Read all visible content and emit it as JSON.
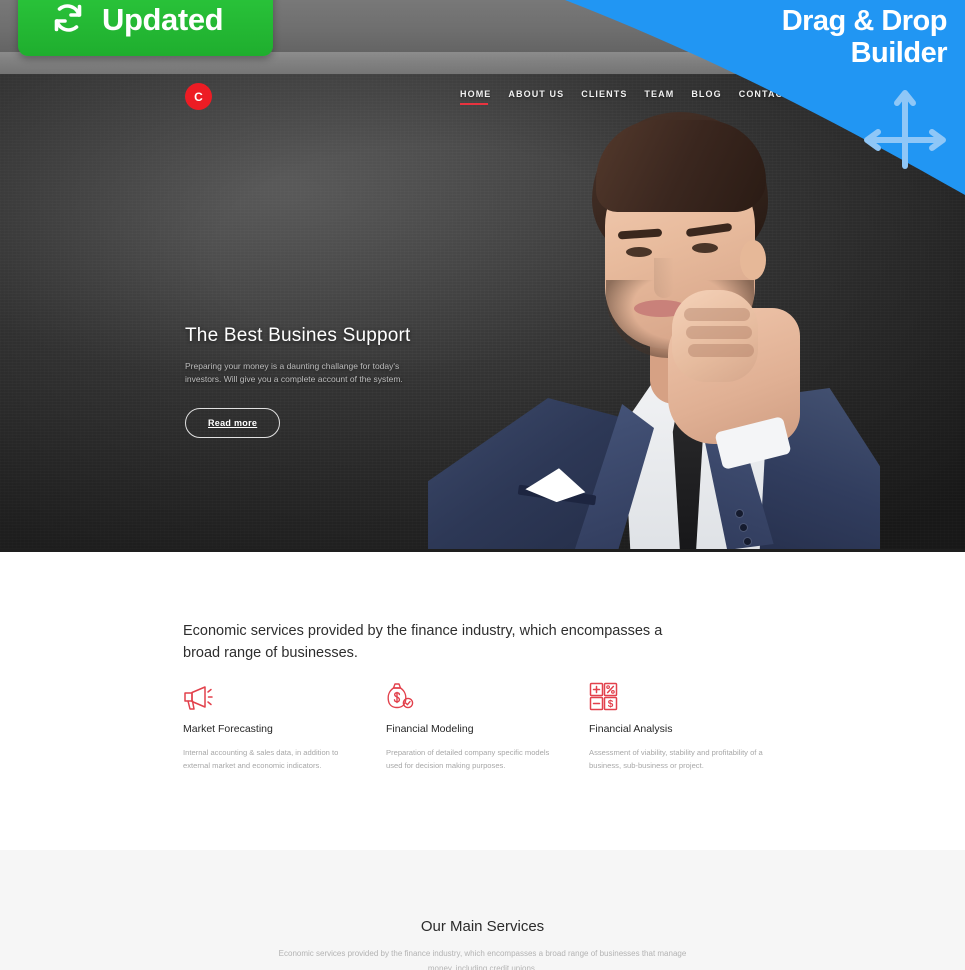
{
  "badges": {
    "updated": {
      "label": "Updated",
      "icon": "sync-refresh-icon",
      "color": "#1fae2e"
    },
    "ribbon": {
      "line1": "Drag & Drop",
      "line2": "Builder",
      "icon": "four-way-drag-arrows-icon",
      "color": "#2196f3"
    }
  },
  "site": {
    "logo": {
      "letter": "C",
      "color": "#ed1c24"
    },
    "nav": [
      {
        "label": "HOME",
        "active": true
      },
      {
        "label": "ABOUT US",
        "active": false
      },
      {
        "label": "CLIENTS",
        "active": false
      },
      {
        "label": "TEAM",
        "active": false
      },
      {
        "label": "BLOG",
        "active": false
      },
      {
        "label": "CONTACTS",
        "active": false
      }
    ]
  },
  "hero": {
    "title": "The Best Busines Support",
    "subtitle": "Preparing your money is a daunting challange for today's investors. Will give you a complete account of the system.",
    "button": "Read more",
    "image_alt": "businessman-in-navy-suit-photo"
  },
  "services": {
    "lead": "Economic services provided by the finance industry, which encompasses a broad range of businesses.",
    "features": [
      {
        "icon": "megaphone-icon",
        "title": "Market Forecasting",
        "desc": "Internal accounting & sales data, in addition to external market and economic indicators."
      },
      {
        "icon": "money-bag-icon",
        "title": "Financial Modeling",
        "desc": "Preparation of detailed company specific models used for decision making purposes."
      },
      {
        "icon": "calculator-icon",
        "title": "Financial Analysis",
        "desc": "Assessment of viability, stability and profitability of a business, sub-business or project."
      }
    ]
  },
  "main_services": {
    "title": "Our Main Services",
    "subtitle": "Economic services provided by the finance industry, which encompasses a broad range of businesses that manage money, including credit unions."
  },
  "theme": {
    "accent_red": "#e8333f",
    "badge_green": "#1fae2e",
    "ribbon_blue": "#2196f3",
    "grey_section": "#f6f6f6"
  }
}
